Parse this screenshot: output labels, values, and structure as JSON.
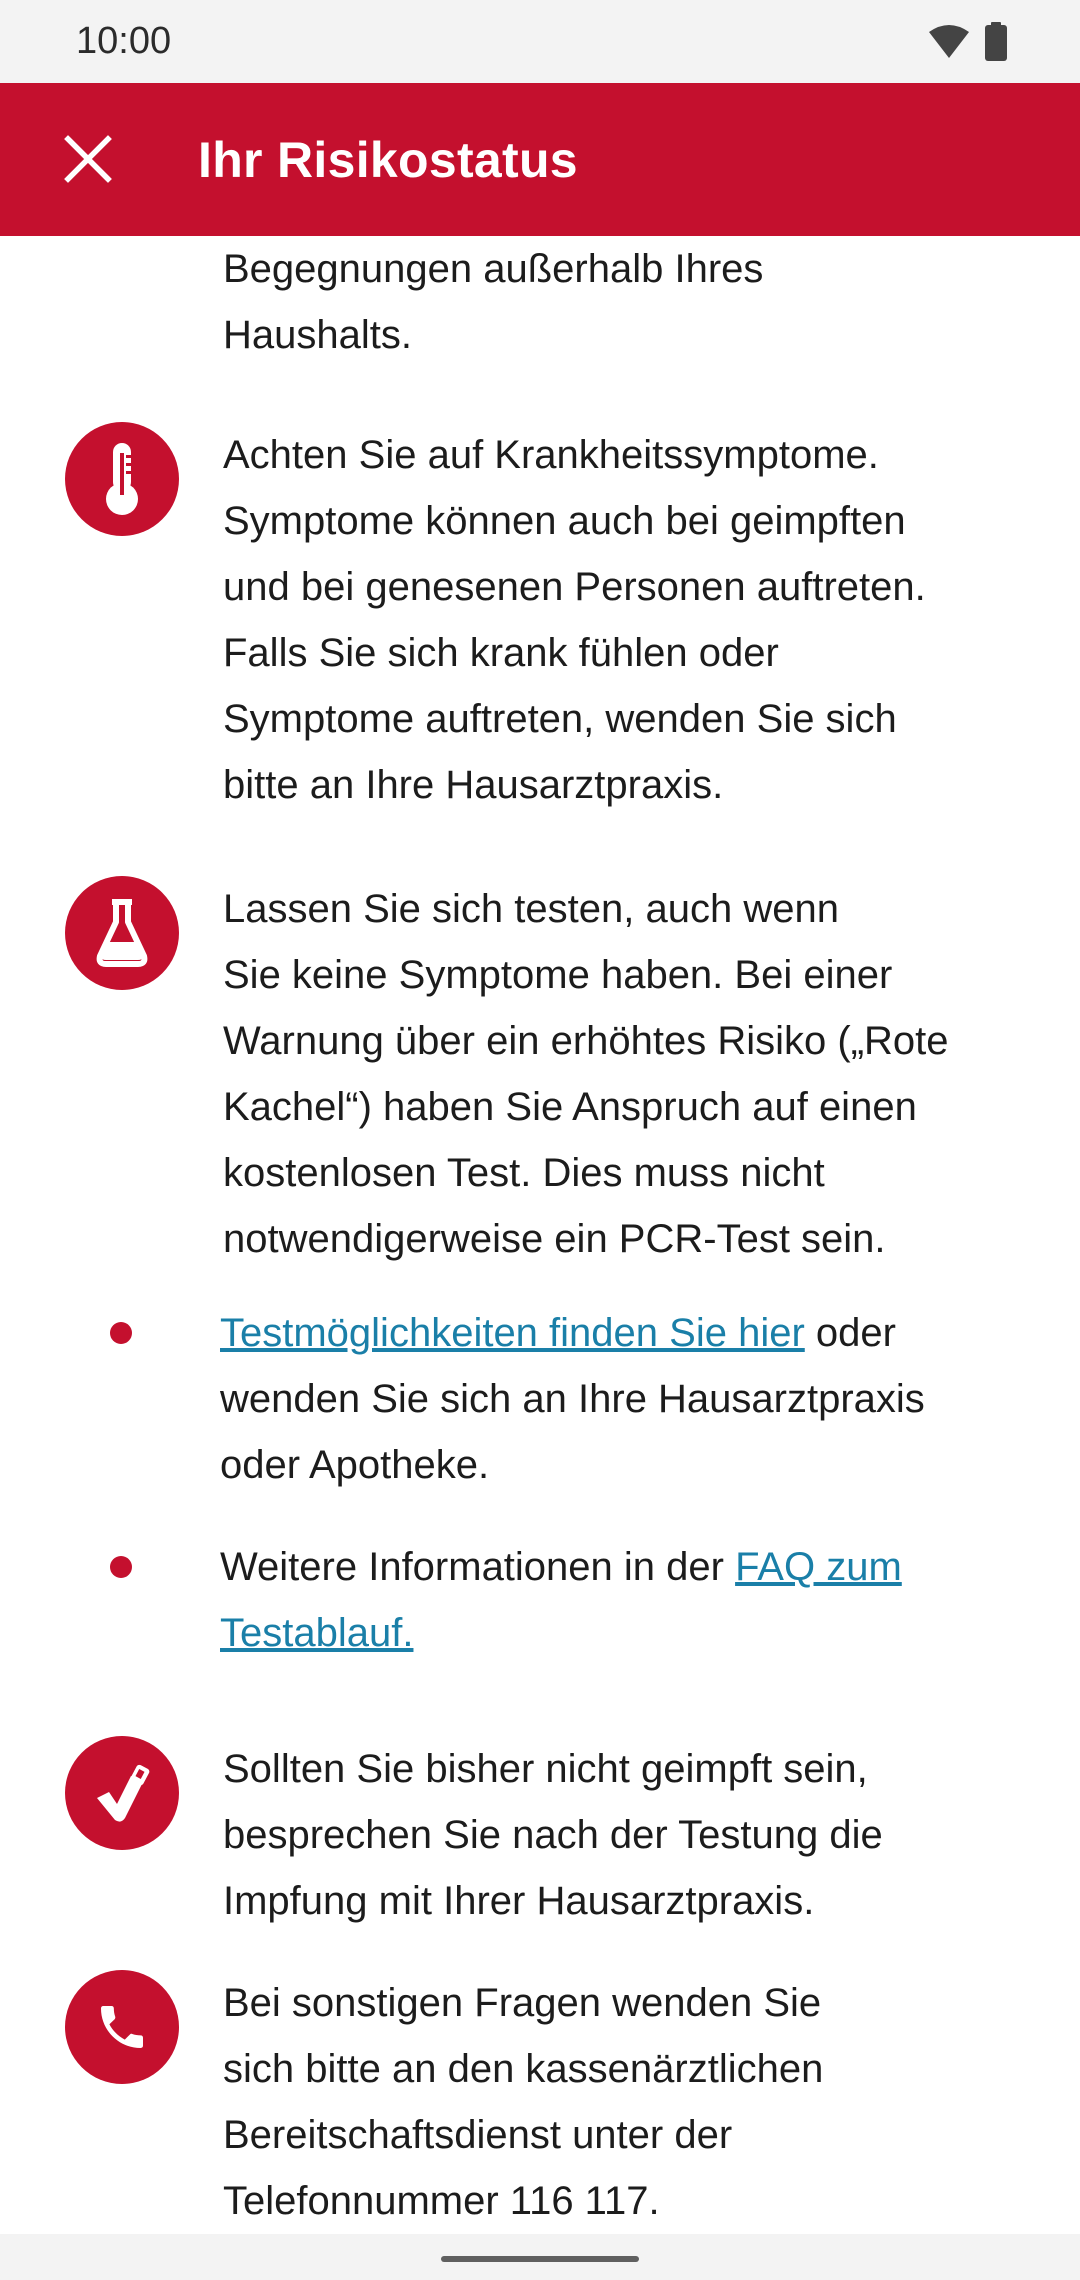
{
  "status_bar": {
    "time": "10:00"
  },
  "header": {
    "title": "Ihr Risikostatus"
  },
  "content": {
    "intro": {
      "line1": "Begegnungen außerhalb Ihres",
      "line2": "Haushalts."
    },
    "symptoms": {
      "icon": "thermometer-icon",
      "lines": [
        "Achten Sie auf Krankheitssymptome.",
        "Symptome können auch bei geimpften",
        "und bei genesenen Personen auftreten.",
        "Falls Sie sich krank fühlen oder",
        "Symptome auftreten, wenden Sie sich",
        "bitte an Ihre Hausarztpraxis."
      ]
    },
    "testing": {
      "icon": "flask-icon",
      "lines": [
        "Lassen Sie sich testen, auch wenn",
        "Sie keine Symptome haben. Bei einer",
        "Warnung über ein erhöhtes Risiko („Rote",
        "Kachel“) haben Sie Anspruch auf einen",
        "kostenlosen Test. Dies muss nicht",
        "notwendigerweise ein PCR-Test sein."
      ]
    },
    "bullet1": {
      "link": "Testmöglichkeiten finden Sie hier",
      "after": " oder",
      "line2": "wenden Sie sich an Ihre Hausarztpraxis",
      "line3": "oder Apotheke."
    },
    "bullet2": {
      "before": "Weitere Informationen in der ",
      "link_part1": "FAQ zum",
      "link_part2": "Testablauf."
    },
    "vaccination": {
      "icon": "vaccination-arm-icon",
      "lines": [
        "Sollten Sie bisher nicht geimpft sein,",
        "besprechen Sie nach der Testung die",
        "Impfung mit Ihrer Hausarztpraxis."
      ]
    },
    "contact": {
      "icon": "phone-icon",
      "lines": [
        "Bei sonstigen Fragen wenden Sie",
        "sich bitte an den kassenärztlichen",
        "Bereitschaftsdienst unter der",
        "Telefonnummer 116 117."
      ]
    }
  },
  "colors": {
    "primary": "#c4102e",
    "link": "#1a7fa8",
    "text": "#1c1c1c"
  }
}
